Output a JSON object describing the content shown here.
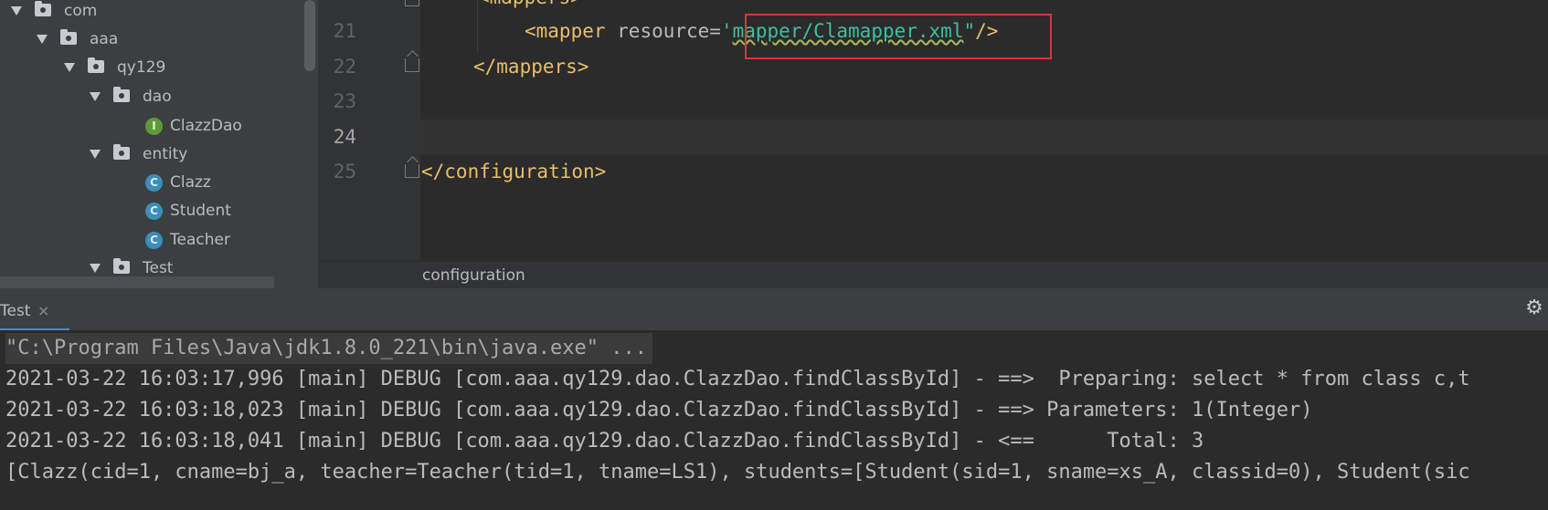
{
  "tree": {
    "items": [
      {
        "label": "com",
        "type": "package"
      },
      {
        "label": "aaa",
        "type": "package"
      },
      {
        "label": "qy129",
        "type": "package"
      },
      {
        "label": "dao",
        "type": "package"
      },
      {
        "label": "ClazzDao",
        "type": "interface",
        "icon_letter": "I"
      },
      {
        "label": "entity",
        "type": "package"
      },
      {
        "label": "Clazz",
        "type": "class",
        "icon_letter": "C"
      },
      {
        "label": "Student",
        "type": "class",
        "icon_letter": "C"
      },
      {
        "label": "Teacher",
        "type": "class",
        "icon_letter": "C"
      },
      {
        "label": "Test",
        "type": "package"
      }
    ]
  },
  "editor": {
    "line_numbers": [
      "21",
      "22",
      "23",
      "24",
      "25"
    ],
    "top_partial_tag": "<mappers>",
    "line21": {
      "open": "<mapper ",
      "attr": "resource=",
      "q1": "'",
      "value": "mapper/Clamapper.xml",
      "q2": "\"",
      "close": "/>"
    },
    "line22": "</mappers>",
    "line25": "</configuration>",
    "breadcrumb": "configuration"
  },
  "run": {
    "tab_label": "Test",
    "close_glyph": "×",
    "gear_glyph": "⚙",
    "console_lines": [
      "\"C:\\Program Files\\Java\\jdk1.8.0_221\\bin\\java.exe\" ...",
      "2021-03-22 16:03:17,996 [main] DEBUG [com.aaa.qy129.dao.ClazzDao.findClassById] - ==>  Preparing: select * from class c,t",
      "2021-03-22 16:03:18,023 [main] DEBUG [com.aaa.qy129.dao.ClazzDao.findClassById] - ==> Parameters: 1(Integer)",
      "2021-03-22 16:03:18,041 [main] DEBUG [com.aaa.qy129.dao.ClazzDao.findClassById] - <==      Total: 3",
      "[Clazz(cid=1, cname=bj_a, teacher=Teacher(tid=1, tname=LS1), students=[Student(sid=1, sname=xs_A, classid=0), Student(sic"
    ]
  },
  "colors": {
    "highlight_box": "#d8373b",
    "tag": "#e8bf6a",
    "string": "#3ec09c",
    "tab_underline": "#4a88c7"
  }
}
